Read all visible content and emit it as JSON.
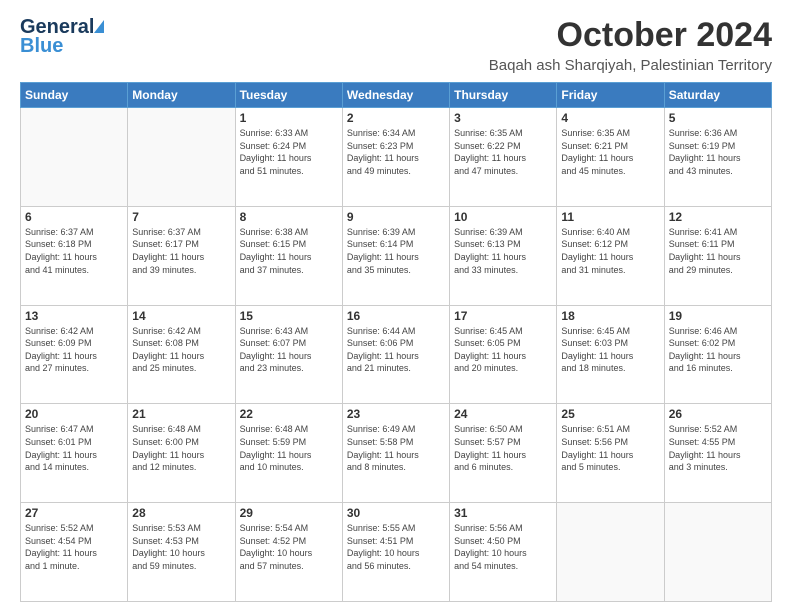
{
  "header": {
    "logo_general": "General",
    "logo_blue": "Blue",
    "month_title": "October 2024",
    "location": "Baqah ash Sharqiyah, Palestinian Territory"
  },
  "weekdays": [
    "Sunday",
    "Monday",
    "Tuesday",
    "Wednesday",
    "Thursday",
    "Friday",
    "Saturday"
  ],
  "weeks": [
    [
      {
        "day": "",
        "lines": []
      },
      {
        "day": "",
        "lines": []
      },
      {
        "day": "1",
        "lines": [
          "Sunrise: 6:33 AM",
          "Sunset: 6:24 PM",
          "Daylight: 11 hours",
          "and 51 minutes."
        ]
      },
      {
        "day": "2",
        "lines": [
          "Sunrise: 6:34 AM",
          "Sunset: 6:23 PM",
          "Daylight: 11 hours",
          "and 49 minutes."
        ]
      },
      {
        "day": "3",
        "lines": [
          "Sunrise: 6:35 AM",
          "Sunset: 6:22 PM",
          "Daylight: 11 hours",
          "and 47 minutes."
        ]
      },
      {
        "day": "4",
        "lines": [
          "Sunrise: 6:35 AM",
          "Sunset: 6:21 PM",
          "Daylight: 11 hours",
          "and 45 minutes."
        ]
      },
      {
        "day": "5",
        "lines": [
          "Sunrise: 6:36 AM",
          "Sunset: 6:19 PM",
          "Daylight: 11 hours",
          "and 43 minutes."
        ]
      }
    ],
    [
      {
        "day": "6",
        "lines": [
          "Sunrise: 6:37 AM",
          "Sunset: 6:18 PM",
          "Daylight: 11 hours",
          "and 41 minutes."
        ]
      },
      {
        "day": "7",
        "lines": [
          "Sunrise: 6:37 AM",
          "Sunset: 6:17 PM",
          "Daylight: 11 hours",
          "and 39 minutes."
        ]
      },
      {
        "day": "8",
        "lines": [
          "Sunrise: 6:38 AM",
          "Sunset: 6:15 PM",
          "Daylight: 11 hours",
          "and 37 minutes."
        ]
      },
      {
        "day": "9",
        "lines": [
          "Sunrise: 6:39 AM",
          "Sunset: 6:14 PM",
          "Daylight: 11 hours",
          "and 35 minutes."
        ]
      },
      {
        "day": "10",
        "lines": [
          "Sunrise: 6:39 AM",
          "Sunset: 6:13 PM",
          "Daylight: 11 hours",
          "and 33 minutes."
        ]
      },
      {
        "day": "11",
        "lines": [
          "Sunrise: 6:40 AM",
          "Sunset: 6:12 PM",
          "Daylight: 11 hours",
          "and 31 minutes."
        ]
      },
      {
        "day": "12",
        "lines": [
          "Sunrise: 6:41 AM",
          "Sunset: 6:11 PM",
          "Daylight: 11 hours",
          "and 29 minutes."
        ]
      }
    ],
    [
      {
        "day": "13",
        "lines": [
          "Sunrise: 6:42 AM",
          "Sunset: 6:09 PM",
          "Daylight: 11 hours",
          "and 27 minutes."
        ]
      },
      {
        "day": "14",
        "lines": [
          "Sunrise: 6:42 AM",
          "Sunset: 6:08 PM",
          "Daylight: 11 hours",
          "and 25 minutes."
        ]
      },
      {
        "day": "15",
        "lines": [
          "Sunrise: 6:43 AM",
          "Sunset: 6:07 PM",
          "Daylight: 11 hours",
          "and 23 minutes."
        ]
      },
      {
        "day": "16",
        "lines": [
          "Sunrise: 6:44 AM",
          "Sunset: 6:06 PM",
          "Daylight: 11 hours",
          "and 21 minutes."
        ]
      },
      {
        "day": "17",
        "lines": [
          "Sunrise: 6:45 AM",
          "Sunset: 6:05 PM",
          "Daylight: 11 hours",
          "and 20 minutes."
        ]
      },
      {
        "day": "18",
        "lines": [
          "Sunrise: 6:45 AM",
          "Sunset: 6:03 PM",
          "Daylight: 11 hours",
          "and 18 minutes."
        ]
      },
      {
        "day": "19",
        "lines": [
          "Sunrise: 6:46 AM",
          "Sunset: 6:02 PM",
          "Daylight: 11 hours",
          "and 16 minutes."
        ]
      }
    ],
    [
      {
        "day": "20",
        "lines": [
          "Sunrise: 6:47 AM",
          "Sunset: 6:01 PM",
          "Daylight: 11 hours",
          "and 14 minutes."
        ]
      },
      {
        "day": "21",
        "lines": [
          "Sunrise: 6:48 AM",
          "Sunset: 6:00 PM",
          "Daylight: 11 hours",
          "and 12 minutes."
        ]
      },
      {
        "day": "22",
        "lines": [
          "Sunrise: 6:48 AM",
          "Sunset: 5:59 PM",
          "Daylight: 11 hours",
          "and 10 minutes."
        ]
      },
      {
        "day": "23",
        "lines": [
          "Sunrise: 6:49 AM",
          "Sunset: 5:58 PM",
          "Daylight: 11 hours",
          "and 8 minutes."
        ]
      },
      {
        "day": "24",
        "lines": [
          "Sunrise: 6:50 AM",
          "Sunset: 5:57 PM",
          "Daylight: 11 hours",
          "and 6 minutes."
        ]
      },
      {
        "day": "25",
        "lines": [
          "Sunrise: 6:51 AM",
          "Sunset: 5:56 PM",
          "Daylight: 11 hours",
          "and 5 minutes."
        ]
      },
      {
        "day": "26",
        "lines": [
          "Sunrise: 5:52 AM",
          "Sunset: 4:55 PM",
          "Daylight: 11 hours",
          "and 3 minutes."
        ]
      }
    ],
    [
      {
        "day": "27",
        "lines": [
          "Sunrise: 5:52 AM",
          "Sunset: 4:54 PM",
          "Daylight: 11 hours",
          "and 1 minute."
        ]
      },
      {
        "day": "28",
        "lines": [
          "Sunrise: 5:53 AM",
          "Sunset: 4:53 PM",
          "Daylight: 10 hours",
          "and 59 minutes."
        ]
      },
      {
        "day": "29",
        "lines": [
          "Sunrise: 5:54 AM",
          "Sunset: 4:52 PM",
          "Daylight: 10 hours",
          "and 57 minutes."
        ]
      },
      {
        "day": "30",
        "lines": [
          "Sunrise: 5:55 AM",
          "Sunset: 4:51 PM",
          "Daylight: 10 hours",
          "and 56 minutes."
        ]
      },
      {
        "day": "31",
        "lines": [
          "Sunrise: 5:56 AM",
          "Sunset: 4:50 PM",
          "Daylight: 10 hours",
          "and 54 minutes."
        ]
      },
      {
        "day": "",
        "lines": []
      },
      {
        "day": "",
        "lines": []
      }
    ]
  ]
}
